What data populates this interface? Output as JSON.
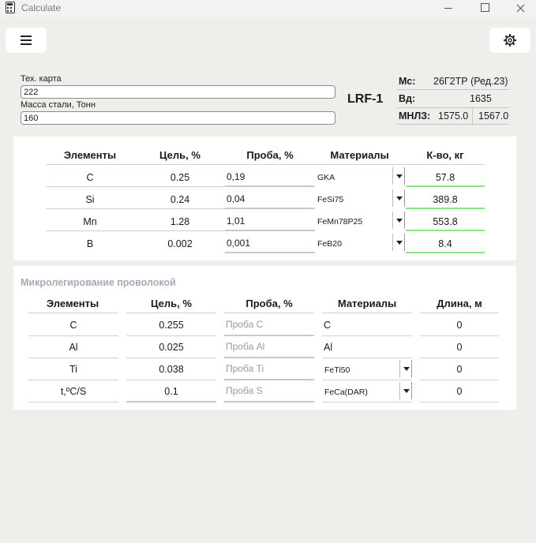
{
  "window": {
    "title": "Calculate"
  },
  "header": {
    "tech_card_label": "Тех. карта",
    "tech_card_value": "222",
    "steel_mass_label": "Масса стали, Тонн",
    "steel_mass_value": "160",
    "unit_name": "LRF-1"
  },
  "info": {
    "mc_label": "Мс:",
    "mc_value": "26Г2ТР (Ред.23)",
    "vd_label": "Вд:",
    "vd_value": "1635",
    "mnlz_label": "МНЛЗ:",
    "mnlz_value1": "1575.0",
    "mnlz_value2": "1567.0"
  },
  "alloy_table": {
    "headers": [
      "Элементы",
      "Цель, %",
      "Проба, %",
      "Материалы",
      "К-во, кг"
    ],
    "rows": [
      {
        "element": "C",
        "target": "0.25",
        "probe": "0,19",
        "material": "GKA",
        "amount": "57.8"
      },
      {
        "element": "Si",
        "target": "0.24",
        "probe": "0,04",
        "material": "FeSi75",
        "amount": "389.8"
      },
      {
        "element": "Mn",
        "target": "1.28",
        "probe": "1,01",
        "material": "FeMn78P25",
        "amount": "553.8"
      },
      {
        "element": "B",
        "target": "0.002",
        "probe": "0,001",
        "material": "FeB20",
        "amount": "8.4"
      }
    ]
  },
  "wire_table": {
    "title": "Микролегирование проволокой",
    "headers": [
      "Элементы",
      "Цель, %",
      "Проба, %",
      "Материалы",
      "Длина, м"
    ],
    "rows": [
      {
        "element": "C",
        "target": "0.255",
        "probe_placeholder": "Проба C",
        "material": "C",
        "length": "0"
      },
      {
        "element": "Al",
        "target": "0.025",
        "probe_placeholder": "Проба Al",
        "material": "Al",
        "length": "0"
      },
      {
        "element": "Ti",
        "target": "0.038",
        "probe_placeholder": "Проба Ti",
        "material": "FeTi50",
        "length": "0"
      },
      {
        "element": "t,ºC/S",
        "target": "0.1",
        "probe_placeholder": "Проба S",
        "material": "FeCa(DAR)",
        "length": "0"
      }
    ]
  }
}
